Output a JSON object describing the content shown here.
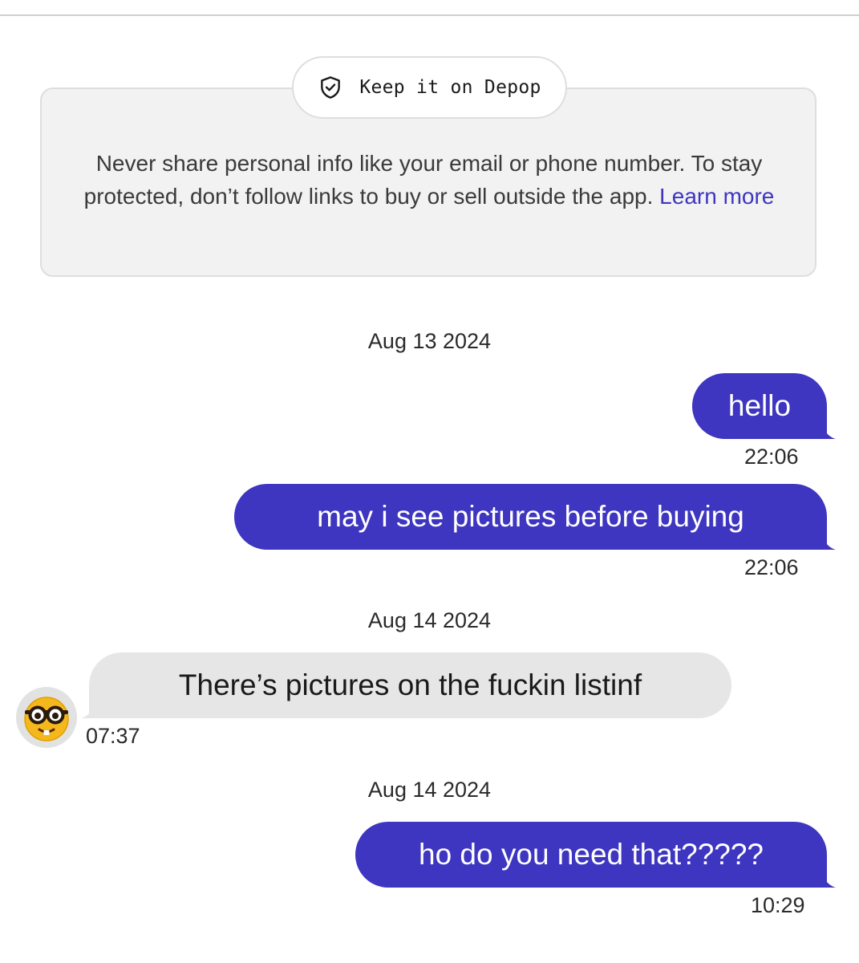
{
  "safety": {
    "pill_label": "Keep it on Depop",
    "pill_icon": "shield-check-icon",
    "message": "Never share personal info like your email or phone number. To stay protected, don’t follow links to buy or sell outside the app.",
    "learn_more": "Learn more"
  },
  "colors": {
    "accent": "#3e36c0",
    "incoming_bubble": "#e6e6e6",
    "card_bg": "#f2f2f2"
  },
  "conversation": [
    {
      "date": "Aug 13 2024"
    },
    {
      "messages": [
        {
          "direction": "outgoing",
          "text": "hello",
          "time": "22:06"
        },
        {
          "direction": "outgoing",
          "text": "may i see pictures before buying",
          "time": "22:06"
        }
      ]
    },
    {
      "date": "Aug 14 2024"
    },
    {
      "messages": [
        {
          "direction": "incoming",
          "text": "There’s pictures on the fuckin listinf",
          "time": "07:37",
          "avatar": "nerd-face-emoji"
        }
      ]
    },
    {
      "date": "Aug 14 2024"
    },
    {
      "messages": [
        {
          "direction": "outgoing",
          "text": "ho do you need that?????",
          "time": "10:29"
        }
      ]
    }
  ]
}
